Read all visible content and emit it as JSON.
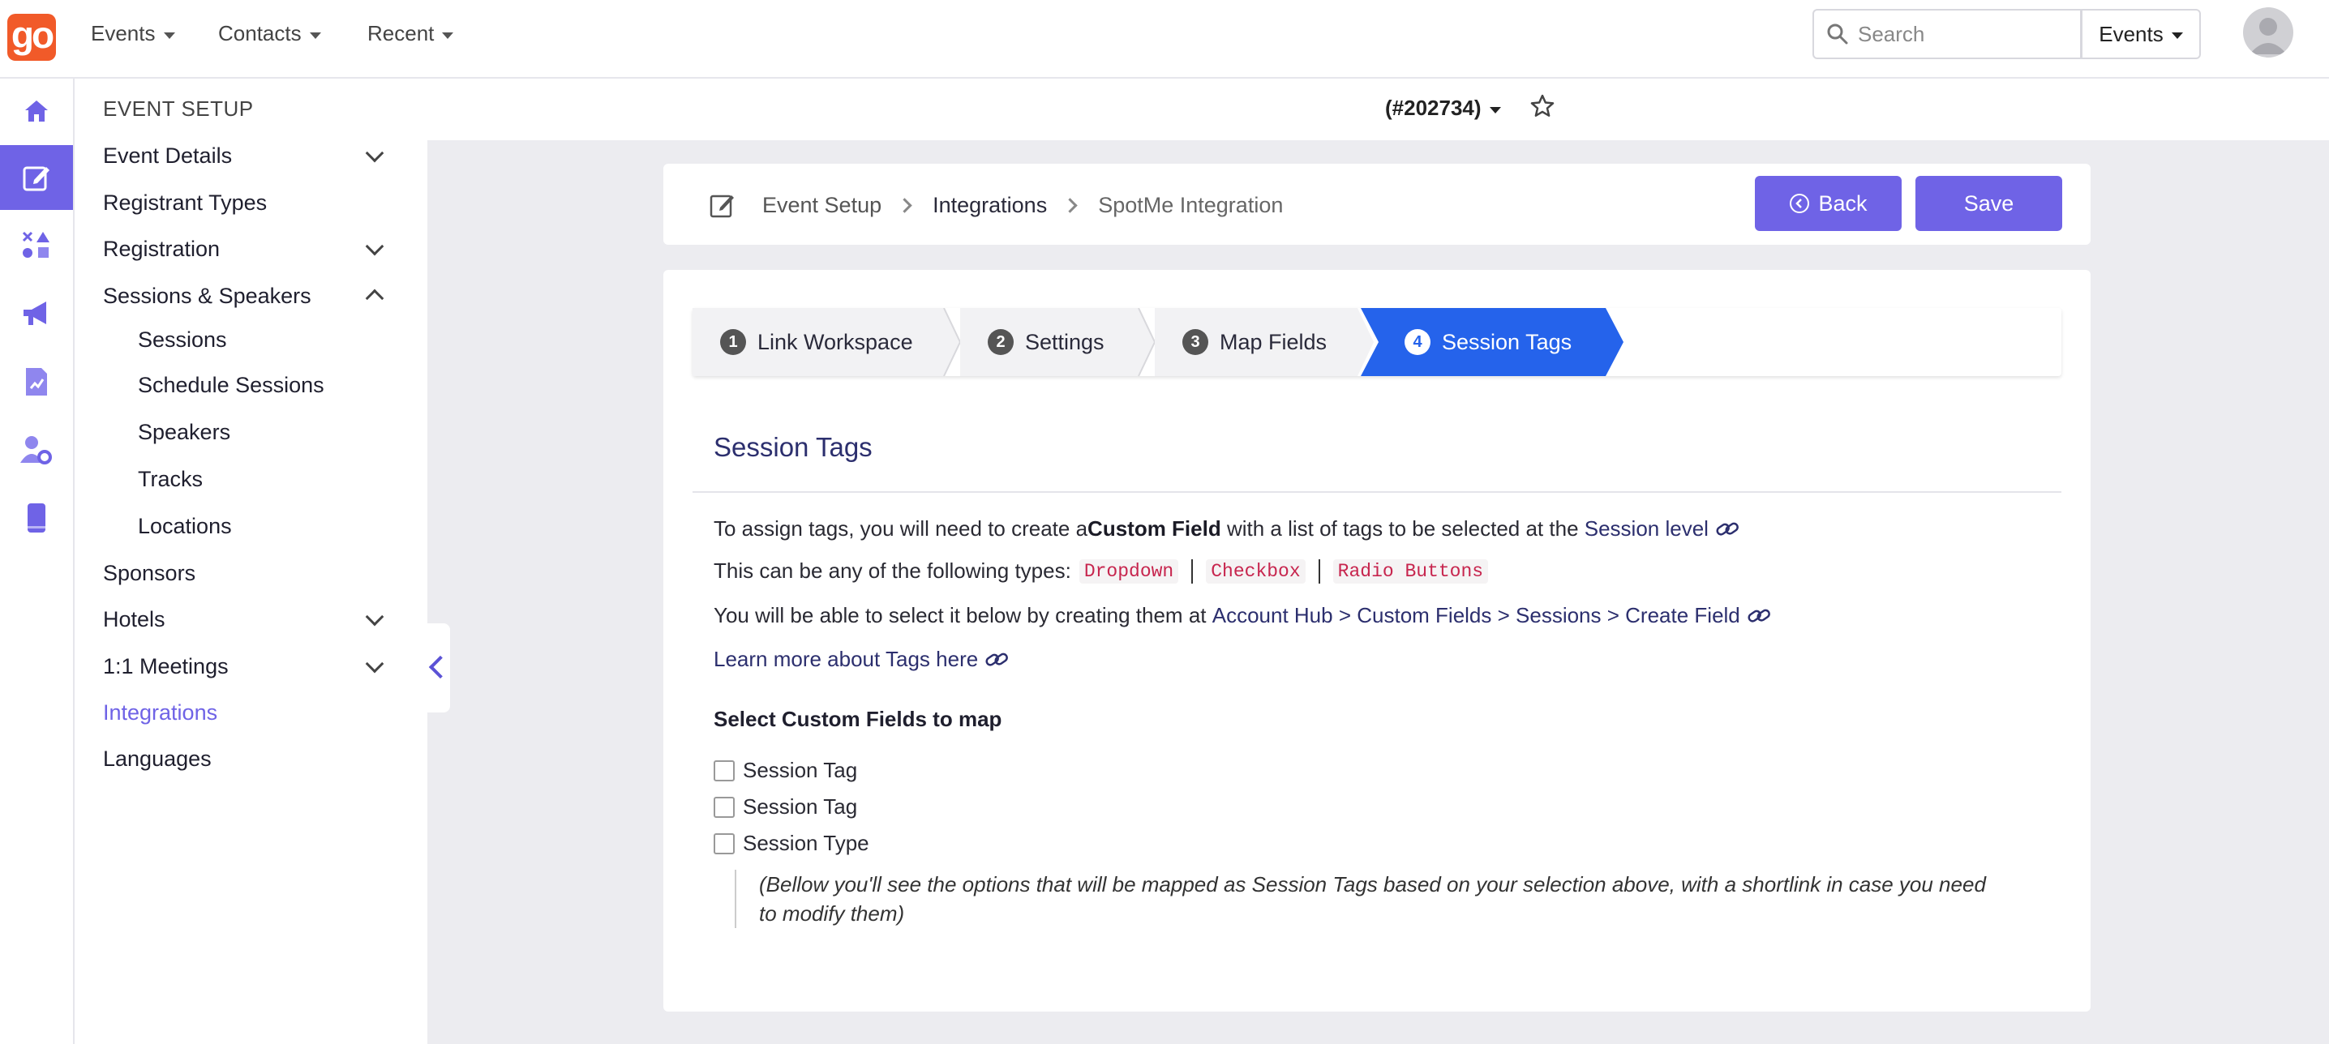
{
  "topnav": {
    "logo": "go",
    "menus": [
      "Events",
      "Contacts",
      "Recent"
    ],
    "search_placeholder": "Search",
    "search_scope": "Events"
  },
  "rail": {
    "items": [
      "home-icon",
      "edit-icon",
      "shapes-icon",
      "megaphone-icon",
      "report-icon",
      "user-settings-icon",
      "mobile-icon"
    ],
    "active_index": 1
  },
  "subnav": {
    "title": "EVENT SETUP",
    "items": [
      {
        "label": "Event Details"
      },
      {
        "label": "Registrant Types"
      },
      {
        "label": "Registration"
      },
      {
        "label": "Sessions & Speakers"
      },
      {
        "label": "Sessions"
      },
      {
        "label": "Schedule Sessions"
      },
      {
        "label": "Speakers"
      },
      {
        "label": "Tracks"
      },
      {
        "label": "Locations"
      },
      {
        "label": "Sponsors"
      },
      {
        "label": "Hotels"
      },
      {
        "label": "1:1 Meetings"
      },
      {
        "label": "Integrations"
      },
      {
        "label": "Languages"
      }
    ]
  },
  "header": {
    "event_id": "(#202734)"
  },
  "breadcrumb": {
    "items": [
      "Event Setup",
      "Integrations",
      "SpotMe Integration"
    ]
  },
  "actions": {
    "back": "Back",
    "save": "Save"
  },
  "steps": [
    {
      "num": "1",
      "label": "Link Workspace"
    },
    {
      "num": "2",
      "label": "Settings"
    },
    {
      "num": "3",
      "label": "Map Fields"
    },
    {
      "num": "4",
      "label": "Session Tags"
    }
  ],
  "content": {
    "title": "Session Tags",
    "p1_a": "To assign tags, you will need to create a ",
    "p1_bold": "Custom Field",
    "p1_b": " with a list of tags to be selected at the ",
    "p1_link": "Session level",
    "p2_a": "This can be any of the following types:",
    "types": [
      "Dropdown",
      "Checkbox",
      "Radio Buttons"
    ],
    "p3_a": "You will be able to select it below by creating them at ",
    "p3_link": "Account Hub > Custom Fields > Sessions > Create Field",
    "p4_link": "Learn more about Tags here",
    "select_title": "Select Custom Fields to map",
    "fields": [
      "Session Tag",
      "Session Tag",
      "Session Type"
    ],
    "note": "(Bellow you'll see the options that will be mapped as Session Tags based on your selection above, with a shortlink in case you need to modify them)"
  }
}
